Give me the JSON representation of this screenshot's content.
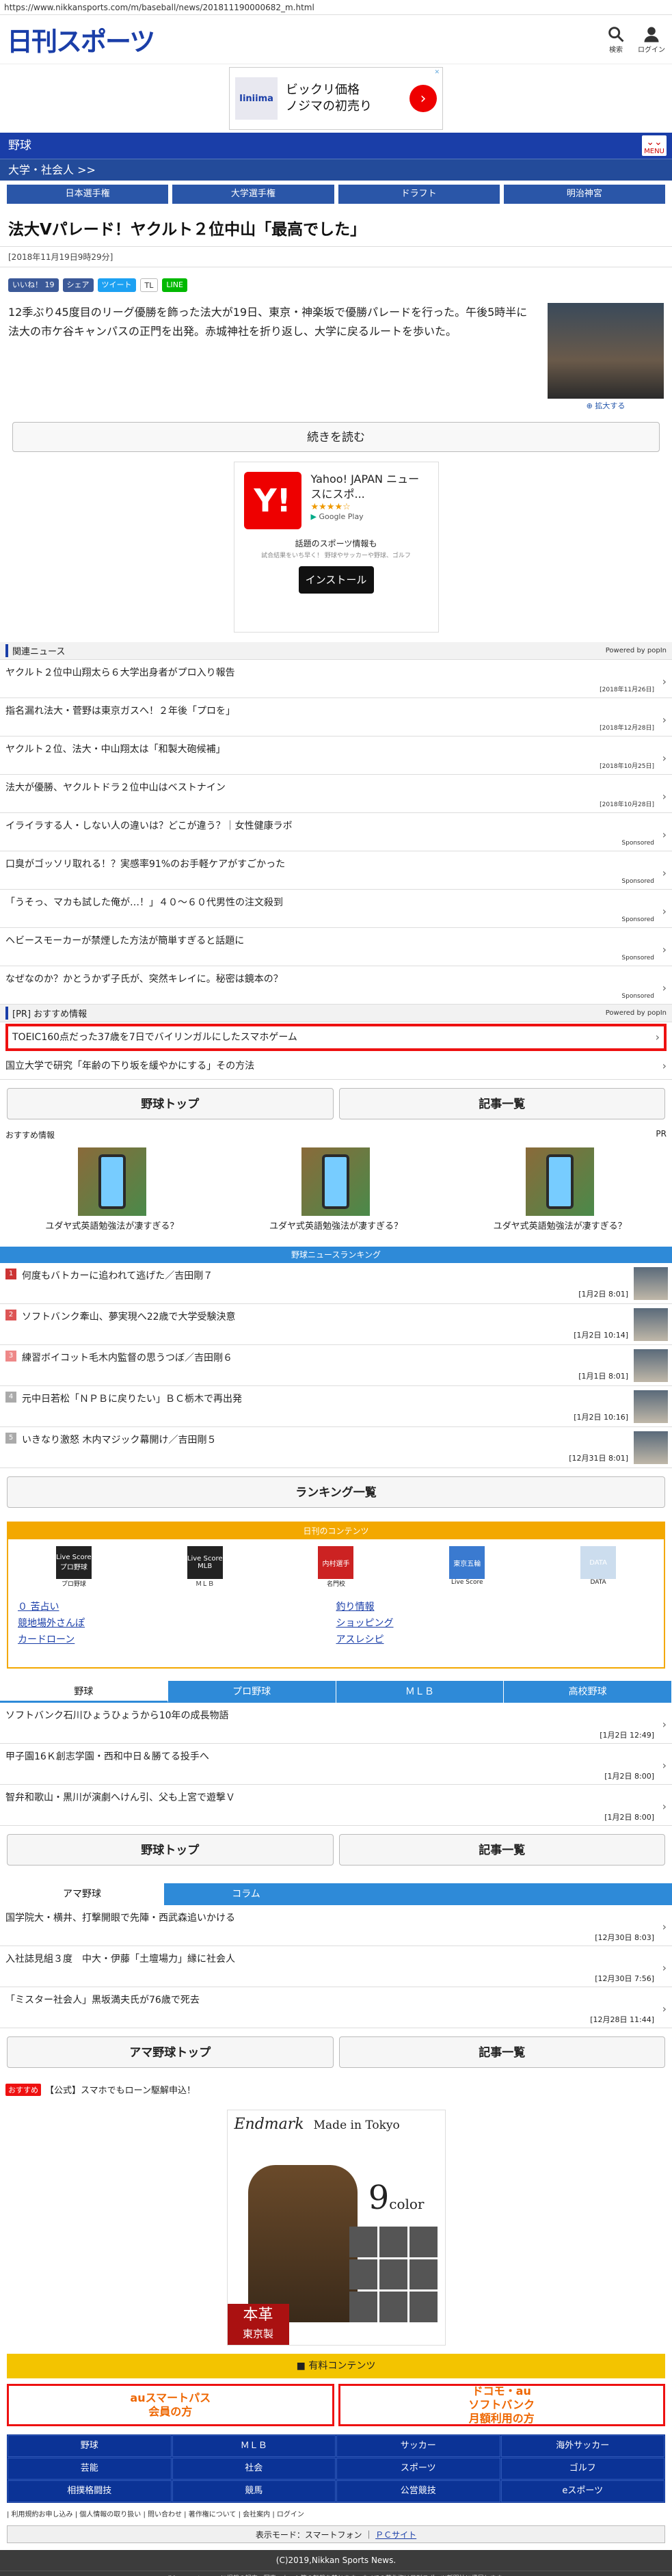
{
  "url": "https://www.nikkansports.com/m/baseball/news/201811190000682_m.html",
  "header": {
    "logo": "日刊スポーツ",
    "search_label": "検索",
    "login_label": "ログイン"
  },
  "ad_top": {
    "brand": "Iiniima",
    "text": "ビックリ価格\nノジマの初売り",
    "ad_mark": "✕"
  },
  "category": {
    "label": "野球",
    "sub": "大学・社会人 >>",
    "menu_label": "MENU"
  },
  "tabs": [
    "日本選手権",
    "大学選手権",
    "ドラフト",
    "明治神宮"
  ],
  "article": {
    "title": "法大Vパレード！ヤクルト２位中山「最高でした」",
    "date": "[2018年11月19日9時29分]",
    "body": "12季ぶり45度目のリーグ優勝を飾った法大が19日、東京・神楽坂で優勝パレードを行った。午後5時半に法大の市ケ谷キャンパスの正門を出発。赤城神社を折り返し、大学に戻るルートを歩いた。",
    "photo_caption": "拡大する",
    "read_more": "続きを読む"
  },
  "share": [
    "いいね！ 19",
    "シェア",
    "ツイート",
    "TL",
    "LINE"
  ],
  "yahoo_ad": {
    "title": "Yahoo! JAPAN ニュースにスポ...",
    "stars": "★★★★☆",
    "store": "Google Play",
    "desc": "話題のスポーツ情報も",
    "desc2": "試合結果をいち早く！ 野球やサッカーや野球、ゴルフ",
    "install": "インストール"
  },
  "related": {
    "title": "関連ニュース",
    "powered": "Powered by popIn",
    "items": [
      {
        "t": "ヤクルト２位中山翔太ら６大学出身者がプロ入り報告",
        "d": "[2018年11月26日]"
      },
      {
        "t": "指名漏れ法大・菅野は東京ガスへ！２年後「プロを」",
        "d": "[2018年12月28日]"
      },
      {
        "t": "ヤクルト２位、法大・中山翔太は「和製大砲候補」",
        "d": "[2018年10月25日]"
      },
      {
        "t": "法大が優勝、ヤクルトドラ２位中山はベストナイン",
        "d": "[2018年10月28日]"
      },
      {
        "t": "イライラする人・しない人の違いは？どこが違う？｜女性健康ラボ",
        "d": "Sponsored"
      },
      {
        "t": "口臭がゴッソリ取れる！？実感率91%のお手軽ケアがすごかった",
        "d": "Sponsored"
      },
      {
        "t": "「うそっ、マカも試した俺が…！」４０〜６０代男性の注文殺到",
        "d": "Sponsored"
      },
      {
        "t": "ヘビースモーカーが禁煙した方法が簡単すぎると話題に",
        "d": "Sponsored"
      },
      {
        "t": "なぜなのか？かとうかず子氏が、突然キレイに。秘密は鏡本の？",
        "d": "Sponsored"
      }
    ]
  },
  "pr": {
    "title": "[PR] おすすめ情報",
    "powered": "Powered by popIn",
    "items": [
      "TOEIC160点だった37歳を7日でバイリンガルにしたスマホゲーム",
      "国立大学で研究「年齢の下り坂を緩やかにする」その方法"
    ]
  },
  "btn": {
    "top": "野球トップ",
    "list": "記事一覧"
  },
  "osusume": {
    "label": "おすすめ情報",
    "pr": "PR",
    "items": [
      "ユダヤ式英語勉強法が凄すぎる？",
      "ユダヤ式英語勉強法が凄すぎる？",
      "ユダヤ式英語勉強法が凄すぎる？"
    ]
  },
  "ranking": {
    "title": "野球ニュースランキング",
    "items": [
      {
        "n": "1",
        "t": "何度もバトカーに追われて逃げた／吉田剛７",
        "d": "[1月2日 8:01]"
      },
      {
        "n": "2",
        "t": "ソフトバンク牽山、夢実現へ22歳で大学受験決意",
        "d": "[1月2日 10:14]"
      },
      {
        "n": "3",
        "t": "練習ボイコット毛木内監督の思うつぼ／吉田剛６",
        "d": "[1月1日 8:01]"
      },
      {
        "n": "4",
        "t": "元中日若松「ＮＰＢに戻りたい」ＢＣ栃木で再出発",
        "d": "[1月2日 10:16]"
      },
      {
        "n": "5",
        "t": "いきなり激怒 木内マジック幕開け／吉田剛５",
        "d": "[12月31日 8:01]"
      }
    ],
    "all": "ランキング一覧"
  },
  "contents": {
    "title": "日刊のコンテンツ",
    "icons": [
      "プロ野球",
      "ＭＬＢ",
      "名門校",
      "Live Score",
      "DATA"
    ],
    "icon_titles": [
      "Live Score プロ野球",
      "Live Score MLB",
      "内村選手",
      "東京五輪",
      "DATA"
    ],
    "links": [
      "０ 苦占い",
      "釣り情報",
      "競地場外さんぽ",
      "ショッピング",
      "カードローン",
      "アスレシピ"
    ]
  },
  "tabbar": [
    "野球",
    "プロ野球",
    "ＭＬＢ",
    "高校野球"
  ],
  "list1": [
    {
      "t": "ソフトバンク石川ひょうひょうから10年の成長物語",
      "d": "[1月2日 12:49]"
    },
    {
      "t": "甲子園16Ｋ創志学園・西和中日＆勝てる投手へ",
      "d": "[1月2日 8:00]"
    },
    {
      "t": "智弁和歌山・黒川が演劇へけん引、父も上宮で遊撃Ｖ",
      "d": "[1月2日 8:00]"
    }
  ],
  "tabbar2": [
    "アマ野球",
    "コラム"
  ],
  "list2": [
    {
      "t": "国学院大・横井、打撃開眼で先陣・西武森追いかける",
      "d": "[12月30日 8:03]"
    },
    {
      "t": "入社誌見組３度　中大・伊藤「土壇場力」縁に社会人",
      "d": "[12月30日 7:56]"
    },
    {
      "t": "「ミスター社会人」黒坂満夫氏が76歳で死去",
      "d": "[12月28日 11:44]"
    }
  ],
  "btn2": {
    "top": "アマ野球トップ",
    "list": "記事一覧"
  },
  "pr2": {
    "tag": "おすすめ",
    "text": "【公式】スマホでもローン駆解申込！"
  },
  "bigad": {
    "title": "Endmark",
    "made": "Made in Tokyo",
    "color": "9",
    "color_word": "color",
    "tag1": "本革",
    "tag2": "東京製"
  },
  "paid": "有料コンテンツ",
  "twobtn": [
    [
      "auスマートパス",
      "会員の方"
    ],
    [
      "ドコモ・au",
      "ソフトバンク",
      "月額利用の方"
    ]
  ],
  "nav": [
    "野球",
    "ＭＬＢ",
    "サッカー",
    "海外サッカー",
    "芸能",
    "社会",
    "スポーツ",
    "ゴルフ",
    "相撲格闘技",
    "競馬",
    "公営競技",
    "eスポーツ"
  ],
  "footlinks": "| 利用規約お申し込み | 個人情報の取り扱い | 問い合わせ | 著作権について | 会社案内 | ログイン",
  "mode": {
    "label": "表示モード：スマートフォン",
    "link": "ＰＣサイト"
  },
  "copyright": "(C)2019,Nikkan Sports News.",
  "copyright2": "nikkansports.com に掲載の記事・写真・カット等の転載を禁じます。すべての著作権は日刊スポーツ新聞社に帰属します。"
}
